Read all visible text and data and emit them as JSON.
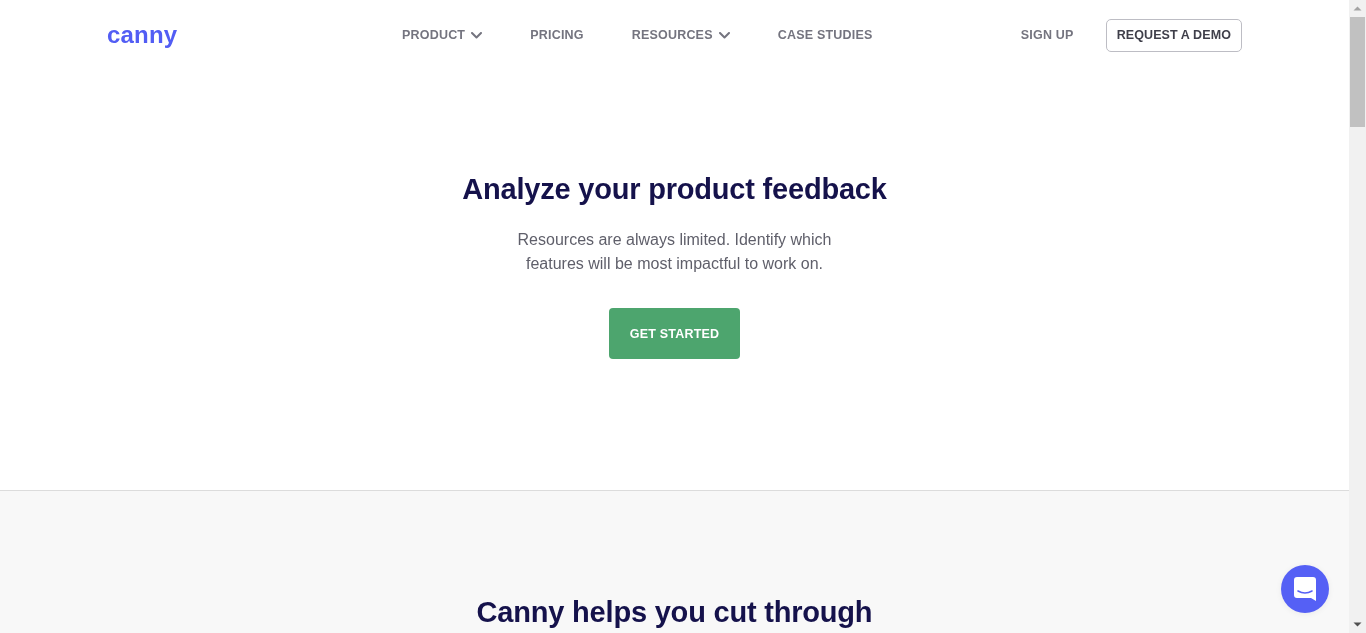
{
  "header": {
    "logo": "canny",
    "nav": [
      {
        "label": "PRODUCT",
        "dropdown": true
      },
      {
        "label": "PRICING",
        "dropdown": false
      },
      {
        "label": "RESOURCES",
        "dropdown": true
      },
      {
        "label": "CASE STUDIES",
        "dropdown": false
      }
    ],
    "sign_up": "SIGN UP",
    "demo_button": "REQUEST A DEMO"
  },
  "hero": {
    "title": "Analyze your product feedback",
    "text": "Resources are always limited. Identify which features will be most impactful to work on.",
    "button": "GET STARTED"
  },
  "section": {
    "title": "Canny helps you cut through"
  }
}
